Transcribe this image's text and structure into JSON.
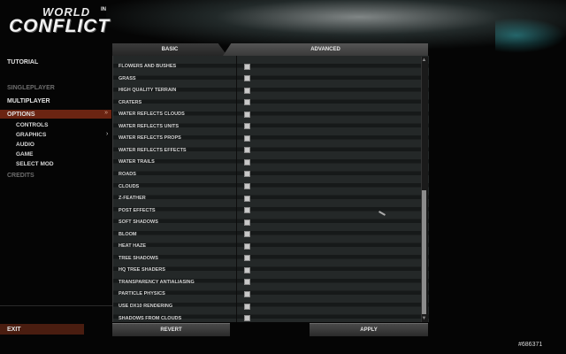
{
  "logo": {
    "line1": "WORLD",
    "small": "IN",
    "line2": "CONFLICT"
  },
  "menu": {
    "tutorial": "TUTORIAL",
    "singleplayer": "SINGLEPLAYER",
    "multiplayer": "MULTIPLAYER",
    "options": "OPTIONS",
    "options_sub": [
      "CONTROLS",
      "GRAPHICS",
      "AUDIO",
      "GAME",
      "SELECT MOD"
    ],
    "credits": "CREDITS",
    "exit": "EXIT",
    "expand_arrow": "»",
    "sub_arrow": "›"
  },
  "tabs": {
    "basic": "BASIC",
    "advanced": "ADVANCED"
  },
  "options": [
    "FLOWERS AND BUSHES",
    "GRASS",
    "HIGH QUALITY TERRAIN",
    "CRATERS",
    "WATER REFLECTS CLOUDS",
    "WATER REFLECTS UNITS",
    "WATER REFLECTS PROPS",
    "WATER REFLECTS EFFECTS",
    "WATER TRAILS",
    "ROADS",
    "CLOUDS",
    "Z-FEATHER",
    "POST EFFECTS",
    "SOFT SHADOWS",
    "BLOOM",
    "HEAT HAZE",
    "TREE SHADOWS",
    "HQ TREE SHADERS",
    "TRANSPARENCY ANTIALIASING",
    "PARTICLE PHYSICS",
    "USE DX10 RENDERING",
    "SHADOWS FROM CLOUDS"
  ],
  "buttons": {
    "revert": "REVERT",
    "apply": "APPLY"
  },
  "watermark": "#686371",
  "colors": {
    "accent": "#6b2412",
    "exit_bar": "#4a1d10"
  }
}
